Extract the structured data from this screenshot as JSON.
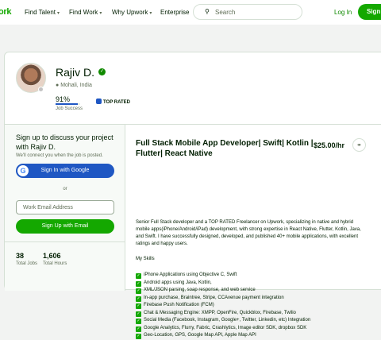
{
  "nav": {
    "logo": "ork",
    "find_talent": "Find Talent",
    "find_work": "Find Work",
    "why_upwork": "Why Upwork",
    "enterprise": "Enterprise",
    "search_placeholder": "Search",
    "login": "Log In",
    "signup": "Sign"
  },
  "profile": {
    "name": "Rajiv D.",
    "location": "Mohali, India",
    "job_success": "91%",
    "job_success_fraction": 0.91,
    "job_success_label": "Job Success",
    "top_rated": "TOP RATED"
  },
  "signup_panel": {
    "title": "Sign up to discuss your project with Rajiv D.",
    "subtitle": "We'll connect you when the job is posted.",
    "google_button": "Sign In with Google",
    "or": "or",
    "email_placeholder": "Work Email Address",
    "email_button": "Sign Up with Email"
  },
  "stats": {
    "total_jobs_value": "38",
    "total_jobs_label": "Total Jobs",
    "total_hours_value": "1,606",
    "total_hours_label": "Total Hours"
  },
  "main": {
    "title": "Full Stack Mobile App Developer| Swift| Kotlin | Flutter| React Native",
    "rate": "$25.00/hr",
    "description": "Senior Full Stack developer and a TOP RATED Freelancer on Upwork, specializing in native and hybrid mobile apps(iPhone/Android/iPad) development, with strong expertise in React Native, Flutter, Kotlin, Java, and Swift. I have successfully designed, developed, and published 40+ mobile applications, with excellent ratings and happy users.",
    "skills_heading": "My Skills",
    "skills": [
      "iPhone Applications using Objective C, Swift",
      "Android apps using Java, Kotlin,",
      "XML/JSON parsing, soap response, and web service",
      "In-app purchase, Braintree, Stripe, CCAvenue payment integration",
      "Firebase Push Notification (FCM)",
      "Chat & Messaging Engine: XMPP, OpenFire, Quickblox, Firebase, Twilio",
      "Social Media (Facebook, Instagram, Google+, Twitter, Linkedin, etc) Integration",
      "Google Analytics, Flurry, Fabric, Crashlytics, Image editor SDK, dropbox SDK",
      "Geo-Location, GPS, Google Map API, Apple Map API"
    ]
  },
  "colors": {
    "brand_green": "#14a800",
    "link_green": "#108a00",
    "accent_blue": "#1f57c3"
  }
}
